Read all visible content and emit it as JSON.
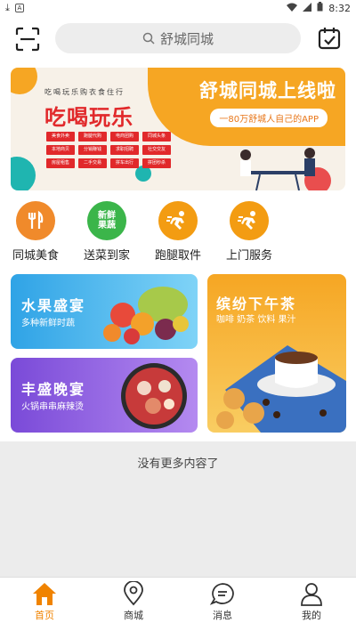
{
  "status": {
    "time": "8:32"
  },
  "header": {
    "search_placeholder": "舒城同城"
  },
  "banner": {
    "headline": "舒城同城上线啦",
    "tagline": "一80万舒城人自己的APP",
    "small_text": "吃喝玩乐购衣食住行",
    "big_text": "吃喝玩乐",
    "tags": [
      "美食外卖",
      "跑腿代购",
      "电商团购",
      "同城头条",
      "本地商贝",
      "分销赚钱",
      "求职招聘",
      "社交交友",
      "房屋租售",
      "二手交易",
      "拼车出行",
      "拼团秒杀"
    ]
  },
  "categories": [
    {
      "label": "同城美食",
      "icon": "fork-knife-icon",
      "color": "#f08a2b"
    },
    {
      "label": "送菜到家",
      "icon": "fresh-produce-icon",
      "color": "#3bb54a",
      "icon_text": "新鲜果蔬"
    },
    {
      "label": "跑腿取件",
      "icon": "runner-icon",
      "color": "#f39c12"
    },
    {
      "label": "上门服务",
      "icon": "runner-icon",
      "color": "#f39c12"
    }
  ],
  "cards": {
    "fruit": {
      "title": "水果盛宴",
      "subtitle": "多种新鲜时蔬"
    },
    "dinner": {
      "title": "丰盛晚宴",
      "subtitle": "火锅串串麻辣烫"
    },
    "tea": {
      "title": "缤纷下午茶",
      "subtitle": "咖啡 奶茶 饮料 果汁"
    }
  },
  "footer_text": "没有更多内容了",
  "tabs": [
    {
      "label": "首页",
      "icon": "home-icon",
      "active": true
    },
    {
      "label": "商城",
      "icon": "map-pin-icon"
    },
    {
      "label": "消息",
      "icon": "chat-icon"
    },
    {
      "label": "我的",
      "icon": "user-icon"
    }
  ],
  "colors": {
    "accent": "#f08300"
  }
}
